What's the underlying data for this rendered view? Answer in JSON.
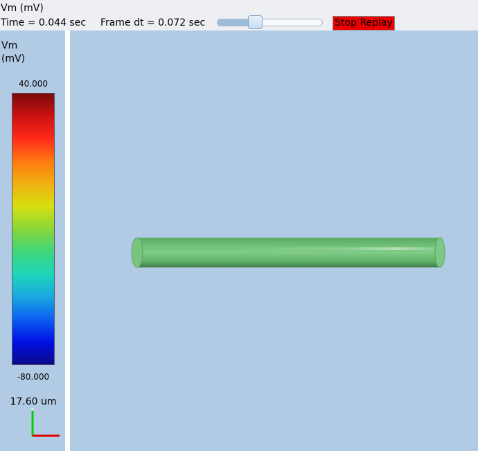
{
  "header": {
    "title": "Vm (mV)",
    "time_label": "Time = 0.044 sec",
    "frame_dt_label": "Frame dt = 0.072 sec",
    "slider": {
      "value": 0.36
    },
    "stop_button": {
      "label": "Stop Replay",
      "color": "#ee0000"
    }
  },
  "colorbar": {
    "title_line1": "Vm",
    "title_line2": "(mV)",
    "max_label": "40.000",
    "min_label": "-80.000",
    "colormap": "jet",
    "stops": [
      "#7b0b0b",
      "#cc1111",
      "#ff2a1a",
      "#ff7a10",
      "#f0b010",
      "#d6e010",
      "#8ad63a",
      "#3fd67c",
      "#1ed6b8",
      "#1aa8e0",
      "#0c5ef0",
      "#0010e6",
      "#0a0a8a"
    ]
  },
  "scale_bar": {
    "label": "17.60 um",
    "y_axis_color": "#00cc00",
    "x_axis_color": "#dd0000"
  },
  "viewport": {
    "background": "#b2cbe4",
    "compartment_color": "#6dbd74",
    "compartment_shape": "cylinder"
  }
}
